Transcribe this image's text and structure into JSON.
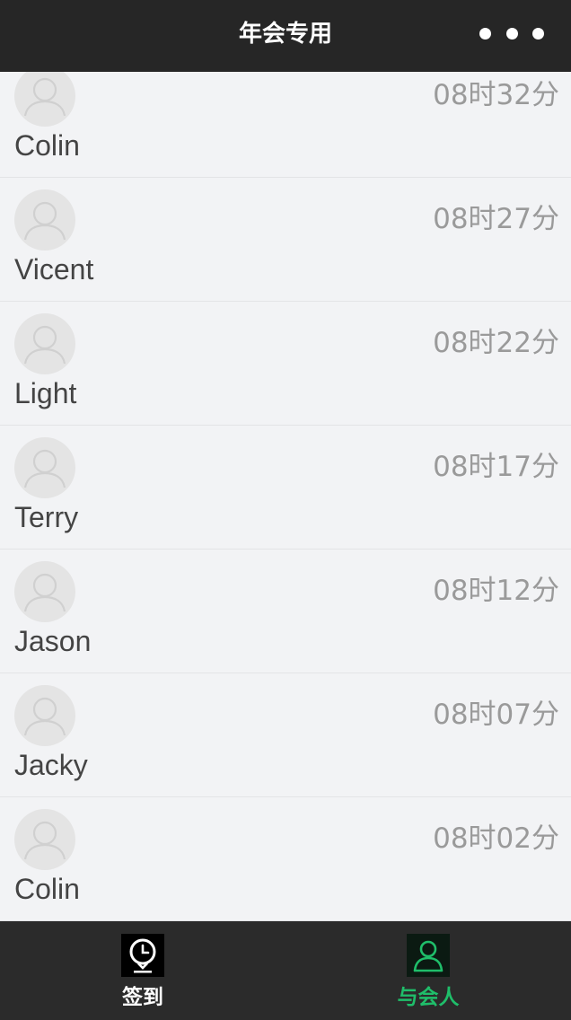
{
  "header": {
    "title": "年会专用",
    "more_icon": "more-dots-icon"
  },
  "attendees": [
    {
      "name": "Colin",
      "time": "08时32分"
    },
    {
      "name": "Vicent",
      "time": "08时27分"
    },
    {
      "name": "Light",
      "time": "08时22分"
    },
    {
      "name": "Terry",
      "time": "08时17分"
    },
    {
      "name": "Jason",
      "time": "08时12分"
    },
    {
      "name": "Jacky",
      "time": "08时07分"
    },
    {
      "name": "Colin",
      "time": "08时02分"
    }
  ],
  "tabbar": {
    "tabs": [
      {
        "label": "签到",
        "icon": "clock-pin-icon",
        "active": false
      },
      {
        "label": "与会人",
        "icon": "person-icon",
        "active": true
      }
    ]
  },
  "colors": {
    "header_bg": "#262626",
    "tabbar_bg": "#2b2b2b",
    "accent": "#1fbe6a",
    "list_bg": "#f2f3f5"
  }
}
